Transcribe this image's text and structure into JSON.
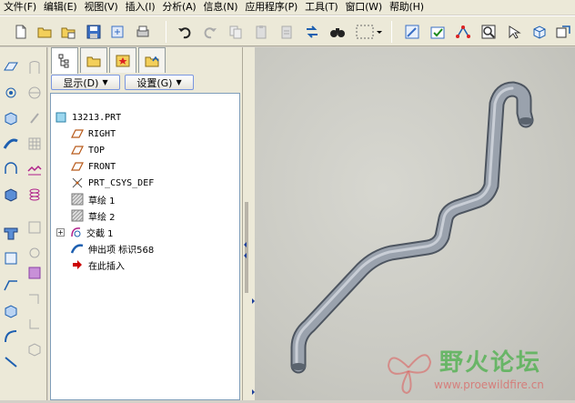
{
  "menu": [
    "文件(F)",
    "编辑(E)",
    "视图(V)",
    "插入(I)",
    "分析(A)",
    "信息(N)",
    "应用程序(P)",
    "工具(T)",
    "窗口(W)",
    "帮助(H)"
  ],
  "nav": {
    "show_label": "显示(D)",
    "settings_label": "设置(G)"
  },
  "tree": {
    "root": "13213.PRT",
    "items": [
      "RIGHT",
      "TOP",
      "FRONT",
      "PRT_CSYS_DEF",
      "草绘 1",
      "草绘 2",
      "交截 1",
      "伸出项 标识568",
      "在此插入"
    ]
  },
  "watermark": {
    "title": "野火论坛",
    "url": "www.proewildfire.cn"
  },
  "colors": {
    "accent": "#3169c6",
    "insert_arrow": "#cc0000",
    "watermark_green": "#4ab04a",
    "watermark_red": "#e05050"
  }
}
